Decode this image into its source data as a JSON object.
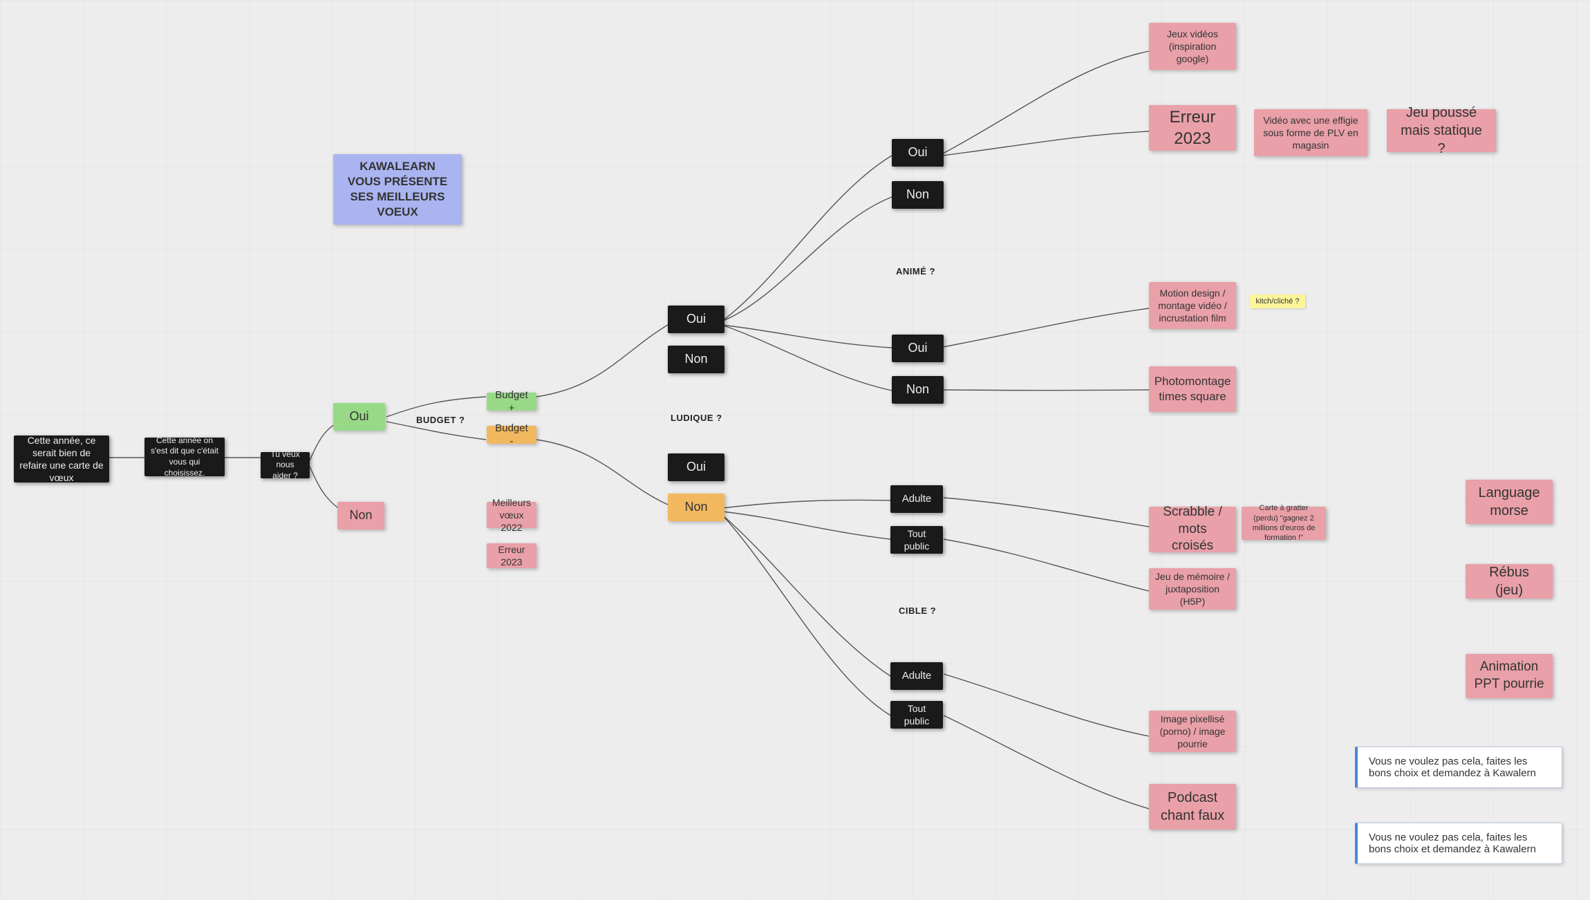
{
  "title": "KAWALEARN VOUS PRÉSENTE SES MEILLEURS VOEUX",
  "intro": {
    "n1": "Cette année, ce serait bien de refaire une carte de vœux",
    "n2": "Cette année on s'est dit que c'était vous qui choisissez.",
    "n3": "Tu veux nous aider ?"
  },
  "help": {
    "yes": "Oui",
    "no": "Non"
  },
  "labels": {
    "budget": "BUDGET ?",
    "anime": "ANIMÉ ?",
    "ludique": "LUDIQUE ?",
    "cible": "CIBLE ?"
  },
  "budget": {
    "plus": "Budget +",
    "minus": "Budget  -"
  },
  "noHelp": {
    "voeux": "Meilleurs vœux 2022",
    "err": "Erreur 2023"
  },
  "ludique": {
    "yes": "Oui",
    "no": "Non"
  },
  "anime": {
    "yes": "Oui",
    "no": "Non"
  },
  "anime2": {
    "yes": "Oui",
    "no": "Non"
  },
  "cible1": {
    "adulte": "Adulte",
    "tout": "Tout public"
  },
  "cible2": {
    "adulte": "Adulte",
    "tout": "Tout public"
  },
  "out": {
    "jeux": "Jeux vidéos (inspiration google)",
    "err2023": "Erreur 2023",
    "plv": "Vidéo avec une effigie sous forme de PLV en magasin",
    "statique": "Jeu poussé mais statique ?",
    "motion": "Motion design / montage vidéo / incrustation film",
    "kitch": "kitch/cliché ?",
    "photomontage": "Photomontage times square",
    "scrabble": "Scrabble / mots croisés",
    "gratter": "Carte à gratter (perdu) \"gagnez 2 millions d'euros de formation !\"",
    "memoire": "Jeu de mémoire / juxtaposition (H5P)",
    "morse": "Language morse",
    "rebus": "Rébus (jeu)",
    "ppt": "Animation PPT pourrie",
    "pixel": "Image pixellisé (porno) / image pourrie",
    "podcast": "Podcast chant faux"
  },
  "callouts": {
    "c1": "Vous ne voulez pas cela, faites les bons choix et demandez à Kawalern",
    "c2": "Vous ne voulez pas cela, faites les bons choix et demandez à Kawalern"
  }
}
